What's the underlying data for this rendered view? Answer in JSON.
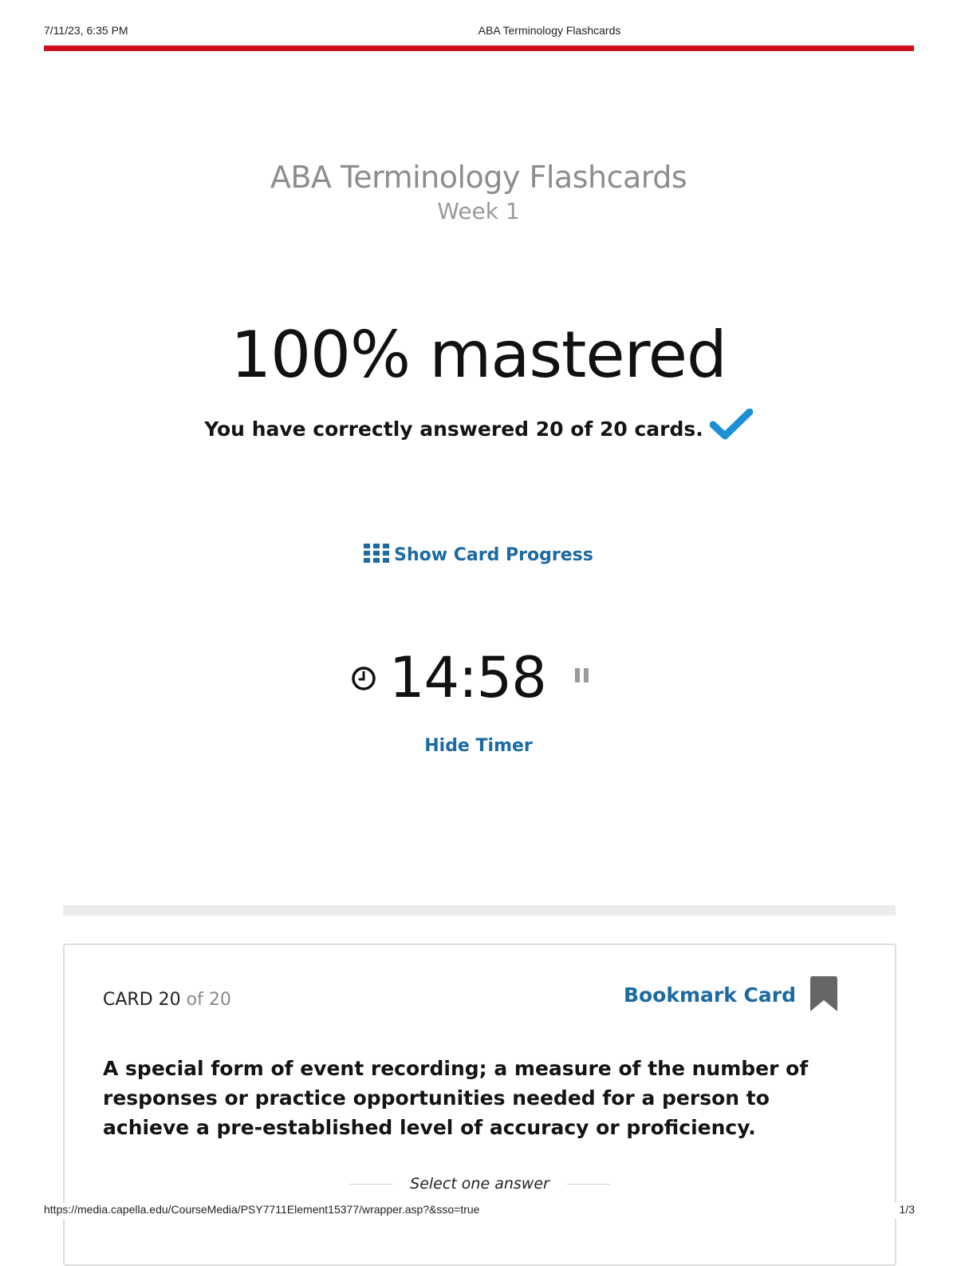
{
  "print_header": {
    "datetime": "7/11/23, 6:35 PM",
    "title": "ABA Terminology Flashcards"
  },
  "deck": {
    "title": "ABA Terminology Flashcards",
    "subtitle": "Week 1"
  },
  "mastery": {
    "headline": "100% mastered",
    "summary": "You have correctly answered 20 of 20 cards.",
    "percent": 100,
    "correct": 20,
    "total": 20
  },
  "progress_link": {
    "label": "Show Card Progress"
  },
  "timer": {
    "value": "14:58",
    "hide_label": "Hide Timer"
  },
  "card": {
    "label": "CARD",
    "current": "20",
    "of_text": "of",
    "total": "20",
    "bookmark_label": "Bookmark Card",
    "question": "A special form of event recording; a measure of the number of responses or practice opportunities needed for a person to achieve a pre-established level of accuracy or proficiency.",
    "select_prompt": "Select one answer"
  },
  "print_footer": {
    "url": "https://media.capella.edu/CourseMedia/PSY7711Element15377/wrapper.asp?&sso=true",
    "page": "1/3"
  },
  "colors": {
    "accent_red": "#d0101e",
    "link_blue": "#1c6aa1",
    "check_blue": "#1d8fd6",
    "muted_gray": "#8d8d8d"
  },
  "icons": [
    "check-icon",
    "grid-icon",
    "clock-icon",
    "pause-icon",
    "bookmark-icon"
  ]
}
